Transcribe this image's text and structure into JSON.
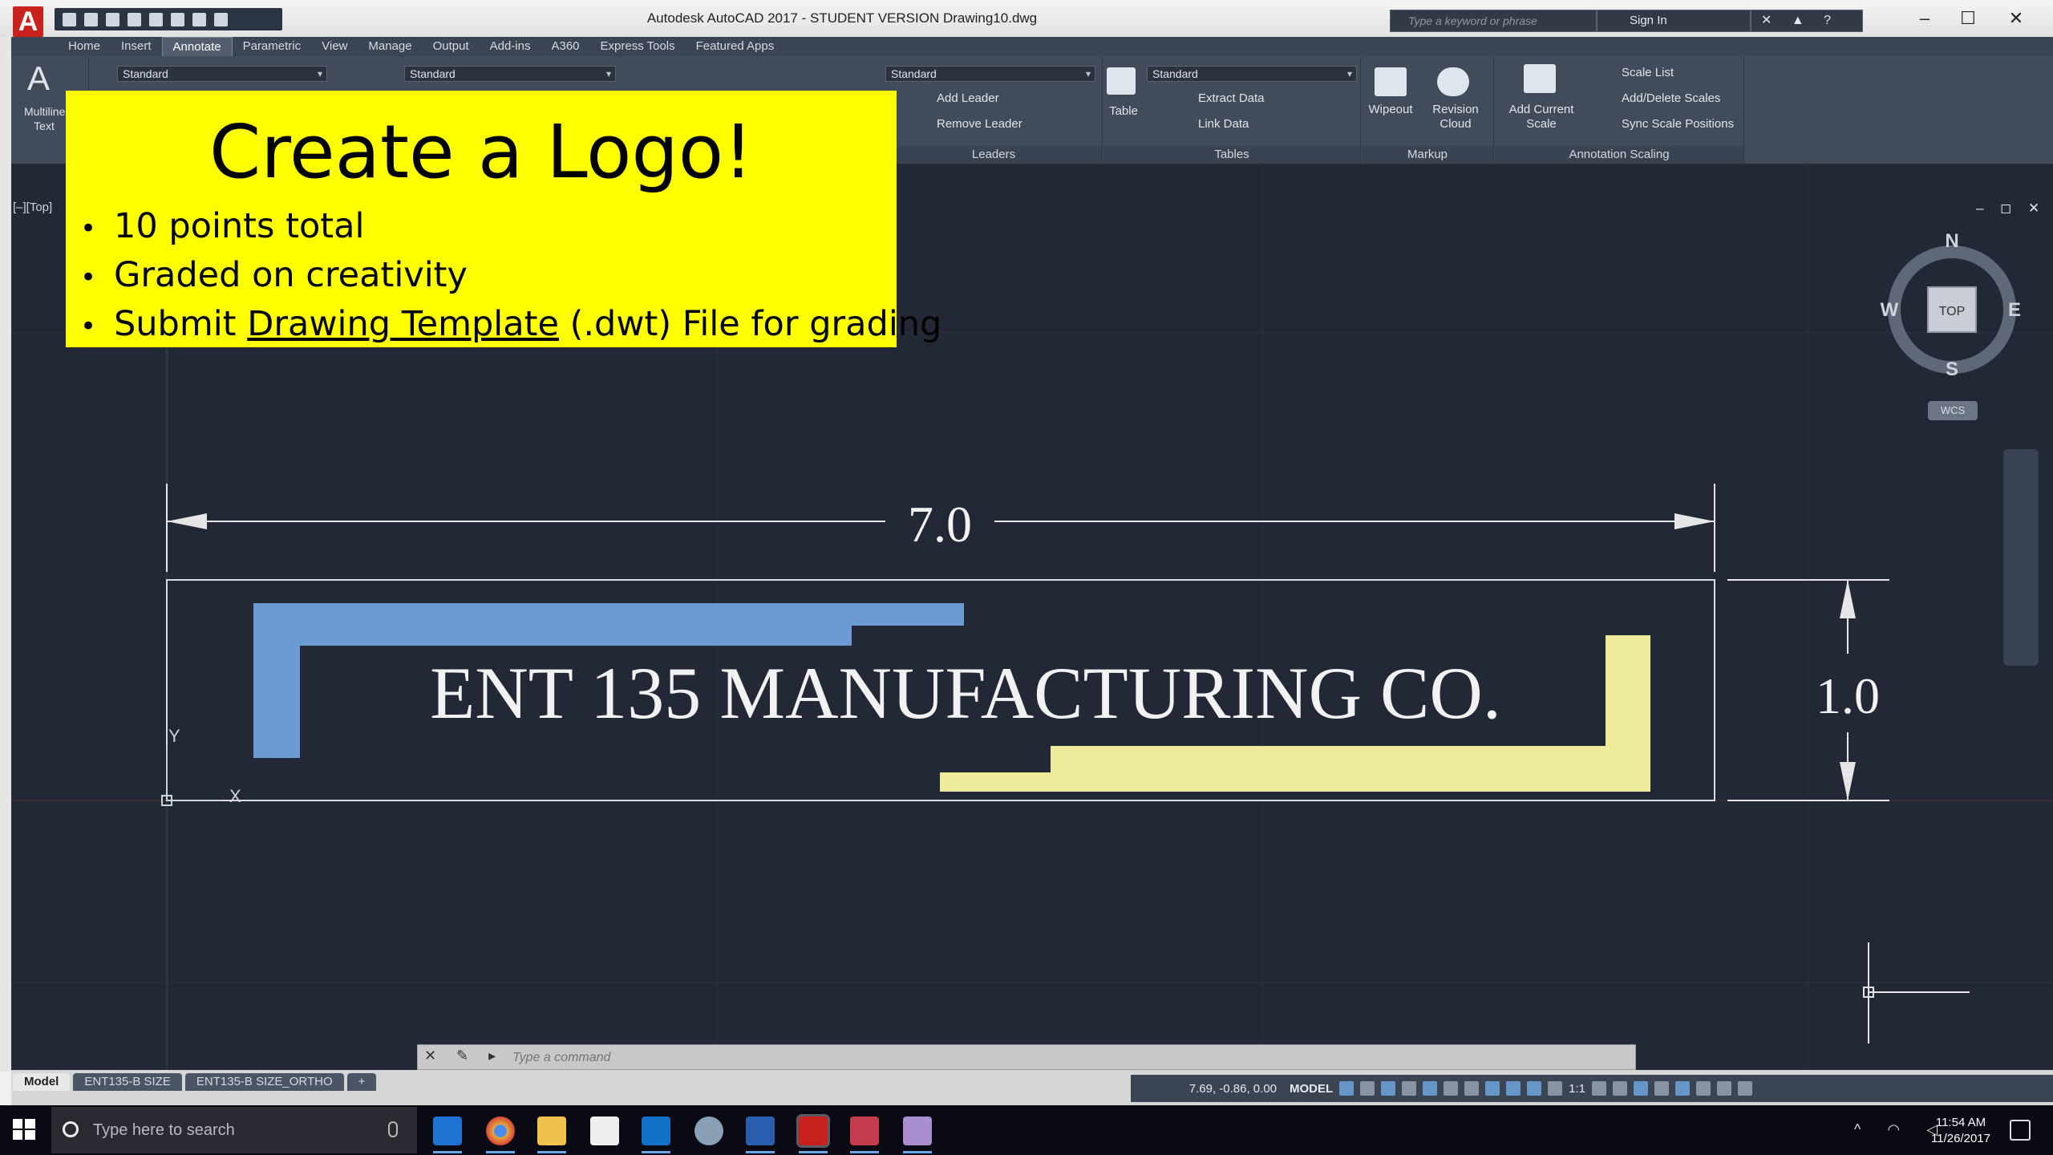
{
  "window": {
    "title": "Autodesk AutoCAD 2017 - STUDENT VERSION    Drawing10.dwg",
    "search_placeholder": "Type a keyword or phrase",
    "sign_in": "Sign In",
    "minimize": "–",
    "maximize": "☐",
    "close": "✕"
  },
  "ribbon": {
    "tabs": [
      "Home",
      "Insert",
      "Annotate",
      "Parametric",
      "View",
      "Manage",
      "Output",
      "Add-ins",
      "A360",
      "Express Tools",
      "Featured Apps"
    ],
    "active_tab": "Annotate",
    "text_panel": {
      "button": "Multiline Text",
      "style": "Standard"
    },
    "dim_style": "Standard",
    "leaders": {
      "style": "Standard",
      "add_leader": "Add Leader",
      "remove_leader": "Remove Leader",
      "title": "Leaders"
    },
    "tables": {
      "style": "Standard",
      "table": "Table",
      "extract_data": "Extract Data",
      "link_data": "Link Data",
      "title": "Tables"
    },
    "markup": {
      "wipeout": "Wipeout",
      "revision_cloud": "Revision Cloud",
      "title": "Markup"
    },
    "annotation_scaling": {
      "add_current_scale": "Add Current Scale",
      "scale_list": "Scale List",
      "add_delete_scales": "Add/Delete Scales",
      "sync_scale_positions": "Sync Scale Positions",
      "title": "Annotation Scaling"
    }
  },
  "viewport": {
    "label": "[–][Top]",
    "controls": "– ◻ ✕",
    "compass": {
      "n": "N",
      "s": "S",
      "e": "E",
      "w": "W",
      "face": "TOP"
    },
    "ucs": "WCS"
  },
  "slide": {
    "title": "Create a Logo!",
    "bullets": [
      {
        "pre": "10 points total"
      },
      {
        "pre": "Graded on creativity"
      },
      {
        "pre": "Submit ",
        "link": "Drawing Template",
        "post": " (.dwt) File for grading"
      }
    ]
  },
  "drawing": {
    "logo_text": "ENT 135 MANUFACTURING CO.",
    "width_dim": "7.0",
    "height_dim": "1.0",
    "ucs_x": "X",
    "ucs_y": "Y",
    "colors": {
      "blue_bar": "#6b9bd2",
      "yellow_bar": "#eeeb9a",
      "background": "#222836"
    }
  },
  "command_line": {
    "placeholder": "Type a command"
  },
  "status": {
    "layout_tabs": [
      "Model",
      "ENT135-B SIZE",
      "ENT135-B SIZE_ORTHO"
    ],
    "add_tab": "+",
    "coords": "7.69, -0.86, 0.00",
    "model": "MODEL",
    "scale": "1:1"
  },
  "taskbar": {
    "search_placeholder": "Type here to search",
    "time": "11:54 AM",
    "date": "11/26/2017"
  }
}
